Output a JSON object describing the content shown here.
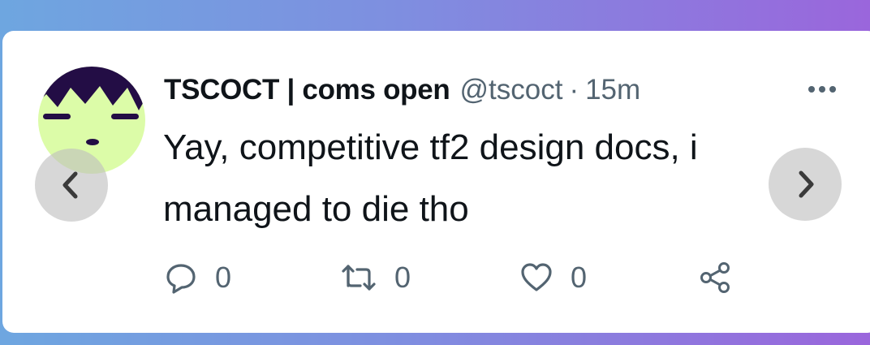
{
  "tweet": {
    "display_name": "TSCOCT | coms open",
    "handle": "@tscoct",
    "separator": "·",
    "time": "15m",
    "text": "Yay, competitive tf2 design docs, i managed to die tho"
  },
  "actions": {
    "reply": {
      "icon": "reply-icon",
      "count": "0"
    },
    "retweet": {
      "icon": "retweet-icon",
      "count": "0"
    },
    "like": {
      "icon": "heart-icon",
      "count": "0"
    },
    "share": {
      "icon": "share-icon"
    }
  },
  "navigation": {
    "prev_icon": "chevron-left-icon",
    "next_icon": "chevron-right-icon"
  },
  "colors": {
    "text_primary": "#0f1419",
    "text_secondary": "#536471",
    "avatar_background": "#dcfca8",
    "avatar_hair": "#230d45",
    "background_gradient_start": "#6ea6e0",
    "background_gradient_end": "#9a66dc"
  }
}
